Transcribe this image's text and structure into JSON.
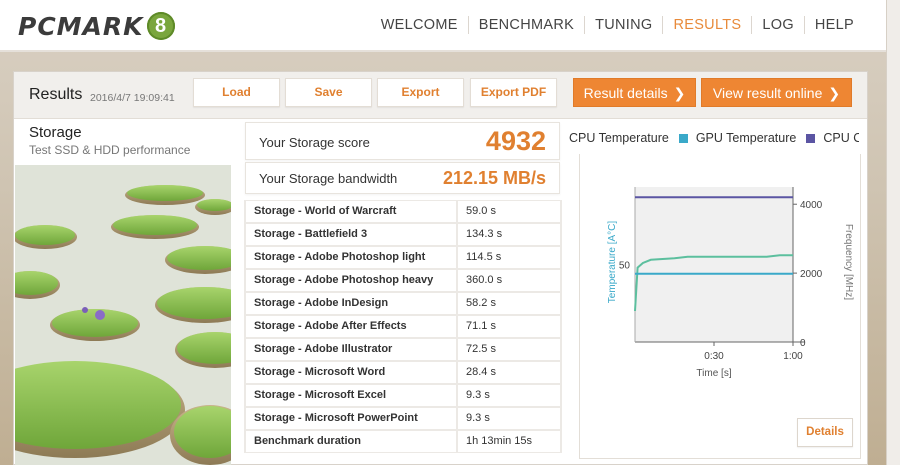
{
  "header": {
    "logo_text": "PCMARK",
    "logo_badge": "8",
    "nav": [
      {
        "label": "WELCOME",
        "active": false
      },
      {
        "label": "BENCHMARK",
        "active": false
      },
      {
        "label": "TUNING",
        "active": false
      },
      {
        "label": "RESULTS",
        "active": true
      },
      {
        "label": "LOG",
        "active": false
      },
      {
        "label": "HELP",
        "active": false
      }
    ]
  },
  "panel": {
    "title": "Results",
    "date": "2016/4/7 19:09:41",
    "buttons": {
      "load": "Load",
      "save": "Save",
      "export": "Export",
      "export_pdf": "Export PDF",
      "result_details": "Result details",
      "view_online": "View result online",
      "chevron": "❯"
    }
  },
  "test": {
    "name": "Storage",
    "subtitle": "Test SSD & HDD performance"
  },
  "scores": {
    "score_label": "Your Storage score",
    "score_value": "4932",
    "bandwidth_label": "Your Storage bandwidth",
    "bandwidth_value": "212.15 MB/s"
  },
  "results_table": [
    {
      "name": "Storage - World of Warcraft",
      "value": "59.0 s"
    },
    {
      "name": "Storage - Battlefield 3",
      "value": "134.3 s"
    },
    {
      "name": "Storage - Adobe Photoshop light",
      "value": "114.5 s"
    },
    {
      "name": "Storage - Adobe Photoshop heavy",
      "value": "360.0 s"
    },
    {
      "name": "Storage - Adobe InDesign",
      "value": "58.2 s"
    },
    {
      "name": "Storage - Adobe After Effects",
      "value": "71.1 s"
    },
    {
      "name": "Storage - Adobe Illustrator",
      "value": "72.5 s"
    },
    {
      "name": "Storage - Microsoft Word",
      "value": "28.4 s"
    },
    {
      "name": "Storage - Microsoft Excel",
      "value": "9.3 s"
    },
    {
      "name": "Storage - Microsoft PowerPoint",
      "value": "9.3 s"
    },
    {
      "name": "Benchmark duration",
      "value": "1h 13min 15s"
    }
  ],
  "legend": [
    {
      "label": "CPU Temperature",
      "color": "#ffffff"
    },
    {
      "label": "GPU Temperature",
      "color": "#3aa9c9"
    },
    {
      "label": "CPU Cl",
      "color": "#5b55a3"
    }
  ],
  "graph": {
    "y_left_label": "Temperature [A°C]",
    "y_left_ticks": [
      "50"
    ],
    "y_right_label": "Frequency [MHz]",
    "y_right_ticks": [
      "4000",
      "2000",
      "0"
    ],
    "x_label": "Time [s]",
    "x_ticks": [
      "0:30",
      "1:00"
    ]
  },
  "details_button": "Details",
  "colors": {
    "accent": "#ee8633",
    "cpu_temp_line": "#5cbf9e",
    "gpu_temp_line": "#3aa9c9",
    "cpu_clock_line": "#5b55a3"
  },
  "chart_data": {
    "type": "line",
    "title": "",
    "xlabel": "Time [s]",
    "ylabel": "Temperature [A°C]",
    "y2label": "Frequency [MHz]",
    "x_unit": "seconds",
    "xlim": [
      0,
      60
    ],
    "y2lim": [
      0,
      4000
    ],
    "series": [
      {
        "name": "CPU Temperature",
        "axis": "left",
        "points": [
          [
            0,
            20
          ],
          [
            1,
            48
          ],
          [
            3,
            51
          ],
          [
            6,
            53
          ],
          [
            15,
            54
          ],
          [
            20,
            55
          ],
          [
            30,
            55
          ],
          [
            40,
            55
          ],
          [
            50,
            55
          ],
          [
            55,
            56
          ],
          [
            60,
            56
          ]
        ]
      },
      {
        "name": "GPU Temperature",
        "axis": "left",
        "points": [
          [
            0,
            44
          ],
          [
            60,
            44
          ]
        ]
      },
      {
        "name": "CPU Cl",
        "axis": "right",
        "points": [
          [
            0,
            4200
          ],
          [
            60,
            4200
          ]
        ]
      }
    ]
  }
}
